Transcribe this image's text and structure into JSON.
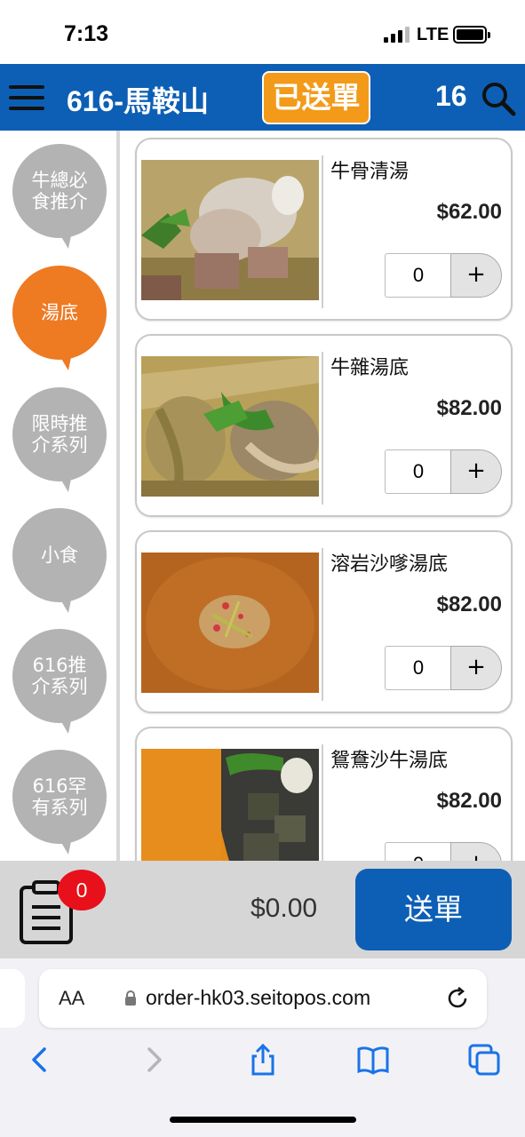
{
  "status_bar": {
    "time": "7:13",
    "network": "LTE",
    "icons": [
      "signal-icon",
      "battery-icon"
    ]
  },
  "header": {
    "menu_icon": "hamburger-menu-icon",
    "store_name": "616-馬鞍山",
    "status_badge": "已送單",
    "table_number": "16",
    "search_icon": "search-icon",
    "colors": {
      "bar": "#0d5fb5",
      "badge": "#f39a1a"
    }
  },
  "sidebar": {
    "categories": [
      {
        "label": "牛總必食推介",
        "active": false
      },
      {
        "label": "湯底",
        "active": true
      },
      {
        "label": "限時推介系列",
        "active": false
      },
      {
        "label": "小食",
        "active": false
      },
      {
        "label": "616推介系列",
        "active": false
      },
      {
        "label": "616罕有系列",
        "active": false
      }
    ],
    "colors": {
      "active": "#ee7a22",
      "inactive": "#b3b3b3"
    }
  },
  "products": [
    {
      "name": "牛骨清湯",
      "price": "$62.00",
      "qty": "0",
      "add": "+"
    },
    {
      "name": "牛雜湯底",
      "price": "$82.00",
      "qty": "0",
      "add": "+"
    },
    {
      "name": "溶岩沙嗲湯底",
      "price": "$82.00",
      "qty": "0",
      "add": "+"
    },
    {
      "name": "鴛鴦沙牛湯底",
      "price": "$82.00",
      "qty": "0",
      "add": "+"
    }
  ],
  "order_bar": {
    "clipboard_icon": "clipboard-icon",
    "item_count": "0",
    "total": "$0.00",
    "submit_label": "送單",
    "colors": {
      "badge": "#e8101a",
      "submit": "#0d5fb5"
    }
  },
  "browser": {
    "text_size_label": "AA",
    "url": "order-hk03.seitopos.com",
    "toolbar_icons": [
      "back-icon",
      "forward-icon",
      "share-icon",
      "bookmarks-icon",
      "tabs-icon"
    ]
  }
}
